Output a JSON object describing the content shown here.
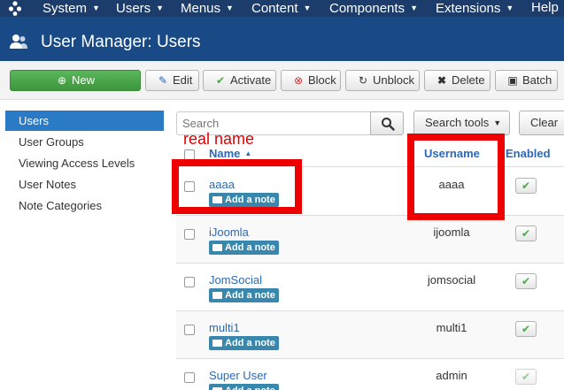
{
  "topnav": {
    "items": [
      "System",
      "Users",
      "Menus",
      "Content",
      "Components",
      "Extensions",
      "Help"
    ]
  },
  "header": {
    "title": "User Manager: Users"
  },
  "toolbar": {
    "new": "New",
    "edit": "Edit",
    "activate": "Activate",
    "block": "Block",
    "unblock": "Unblock",
    "delete": "Delete",
    "batch": "Batch"
  },
  "sidebar": {
    "items": [
      {
        "label": "Users",
        "active": true
      },
      {
        "label": "User Groups",
        "active": false
      },
      {
        "label": "Viewing Access Levels",
        "active": false
      },
      {
        "label": "User Notes",
        "active": false
      },
      {
        "label": "Note Categories",
        "active": false
      }
    ]
  },
  "filters": {
    "search_placeholder": "Search",
    "search_tools": "Search tools",
    "clear": "Clear"
  },
  "table": {
    "headers": {
      "name": "Name",
      "username": "Username",
      "enabled": "Enabled"
    },
    "add_note_label": "Add a note",
    "rows": [
      {
        "name": "aaaa",
        "username": "aaaa",
        "enabled": true
      },
      {
        "name": "iJoomla",
        "username": "ijoomla",
        "enabled": true
      },
      {
        "name": "JomSocial",
        "username": "jomsocial",
        "enabled": true
      },
      {
        "name": "multi1",
        "username": "multi1",
        "enabled": true
      },
      {
        "name": "Super User",
        "username": "admin",
        "enabled": true
      }
    ]
  },
  "annotation": {
    "label": "real name",
    "color": "#ee0000"
  },
  "colors": {
    "nav": "#1c3d6b",
    "header": "#1a4a86",
    "accent": "#2a69b8",
    "active": "#2b7ac5",
    "success": "#4aa84a"
  }
}
